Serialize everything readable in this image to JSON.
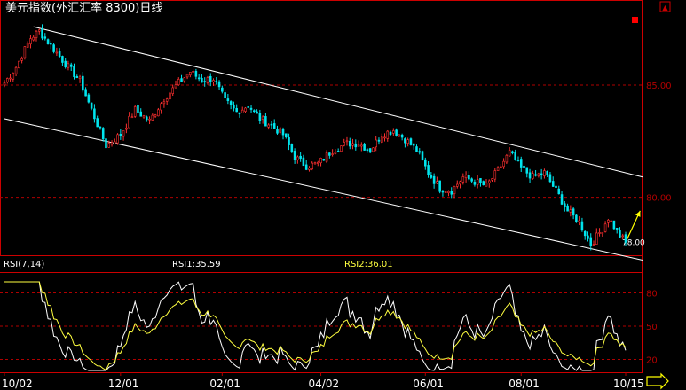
{
  "window": {
    "title": "美元指数(外汇汇率 8300)日线"
  },
  "rsi_panel": {
    "label": "RSI(7,14)",
    "rsi1_label": "RSI1:35.59",
    "rsi2_label": "RSI2:36.01"
  },
  "colors": {
    "background": "#000000",
    "frame": "#cc0000",
    "grid": "#b00000",
    "up_candle": "#ff3030",
    "down_candle": "#00e5ee",
    "channel": "#ffffff",
    "rsi1": "#ffffff",
    "rsi2": "#ffff40",
    "arrow": "#ffff00",
    "title_text": "#ffffff",
    "rsi1_text": "#ffffff",
    "rsi2_text": "#ffff40",
    "nav_arrow": "#ffff00"
  },
  "icons": {
    "scroll_up": "scroll-up-arrow-icon",
    "nav_right": "right-arrow-icon"
  },
  "chart_data": [
    {
      "type": "candlestick",
      "title": "美元指数(外汇汇率 8300)日线",
      "x_tick_labels": [
        "10/02",
        "12/01",
        "02/01",
        "04/02",
        "06/01",
        "08/01",
        "10/15"
      ],
      "y_tick_labels": [
        "85.00",
        "80.00"
      ],
      "ylim": [
        77.5,
        88.0
      ],
      "last_close_label": "78.00",
      "anchors": [
        {
          "i": 0,
          "v": 85.1
        },
        {
          "i": 4,
          "v": 85.8
        },
        {
          "i": 9,
          "v": 87.1
        },
        {
          "i": 12,
          "v": 87.4
        },
        {
          "i": 17,
          "v": 86.6
        },
        {
          "i": 22,
          "v": 85.8
        },
        {
          "i": 26,
          "v": 85.2
        },
        {
          "i": 30,
          "v": 83.9
        },
        {
          "i": 35,
          "v": 82.3
        },
        {
          "i": 40,
          "v": 82.8
        },
        {
          "i": 45,
          "v": 83.9
        },
        {
          "i": 50,
          "v": 83.4
        },
        {
          "i": 55,
          "v": 84.4
        },
        {
          "i": 60,
          "v": 85.1
        },
        {
          "i": 64,
          "v": 85.6
        },
        {
          "i": 68,
          "v": 85.2
        },
        {
          "i": 72,
          "v": 85.3
        },
        {
          "i": 76,
          "v": 84.3
        },
        {
          "i": 80,
          "v": 83.8
        },
        {
          "i": 84,
          "v": 84.1
        },
        {
          "i": 88,
          "v": 83.5
        },
        {
          "i": 92,
          "v": 83.2
        },
        {
          "i": 96,
          "v": 82.8
        },
        {
          "i": 100,
          "v": 81.8
        },
        {
          "i": 104,
          "v": 81.4
        },
        {
          "i": 108,
          "v": 81.5
        },
        {
          "i": 113,
          "v": 82.1
        },
        {
          "i": 118,
          "v": 82.4
        },
        {
          "i": 122,
          "v": 82.4
        },
        {
          "i": 126,
          "v": 82.1
        },
        {
          "i": 130,
          "v": 82.8
        },
        {
          "i": 134,
          "v": 83.0
        },
        {
          "i": 138,
          "v": 82.6
        },
        {
          "i": 142,
          "v": 82.1
        },
        {
          "i": 146,
          "v": 81.1
        },
        {
          "i": 150,
          "v": 80.4
        },
        {
          "i": 154,
          "v": 80.3
        },
        {
          "i": 158,
          "v": 80.9
        },
        {
          "i": 162,
          "v": 80.7
        },
        {
          "i": 166,
          "v": 80.5
        },
        {
          "i": 170,
          "v": 81.2
        },
        {
          "i": 174,
          "v": 82.0
        },
        {
          "i": 178,
          "v": 81.3
        },
        {
          "i": 182,
          "v": 80.9
        },
        {
          "i": 186,
          "v": 81.1
        },
        {
          "i": 190,
          "v": 80.3
        },
        {
          "i": 194,
          "v": 79.4
        },
        {
          "i": 198,
          "v": 78.9
        },
        {
          "i": 202,
          "v": 77.9
        },
        {
          "i": 206,
          "v": 78.6
        },
        {
          "i": 208,
          "v": 79.1
        },
        {
          "i": 212,
          "v": 78.3
        },
        {
          "i": 214,
          "v": 78.0
        }
      ],
      "bar_count": 215,
      "channel_lines": [
        {
          "from": {
            "i": 10,
            "v": 87.6
          },
          "to": {
            "i": 220,
            "v": 80.9
          }
        },
        {
          "from": {
            "i": 0,
            "v": 83.5
          },
          "to": {
            "i": 220,
            "v": 77.2
          }
        }
      ],
      "projection_arrow": {
        "from": {
          "i": 214,
          "v": 78.0
        },
        "to": {
          "i": 219,
          "v": 79.4
        }
      }
    },
    {
      "type": "line",
      "title": "RSI(7,14)",
      "y_tick_labels": [
        "80",
        "50",
        "20"
      ],
      "ylim": [
        10,
        90
      ],
      "series": [
        {
          "name": "RSI1",
          "last": 35.59
        },
        {
          "name": "RSI2",
          "last": 36.01
        }
      ]
    }
  ]
}
